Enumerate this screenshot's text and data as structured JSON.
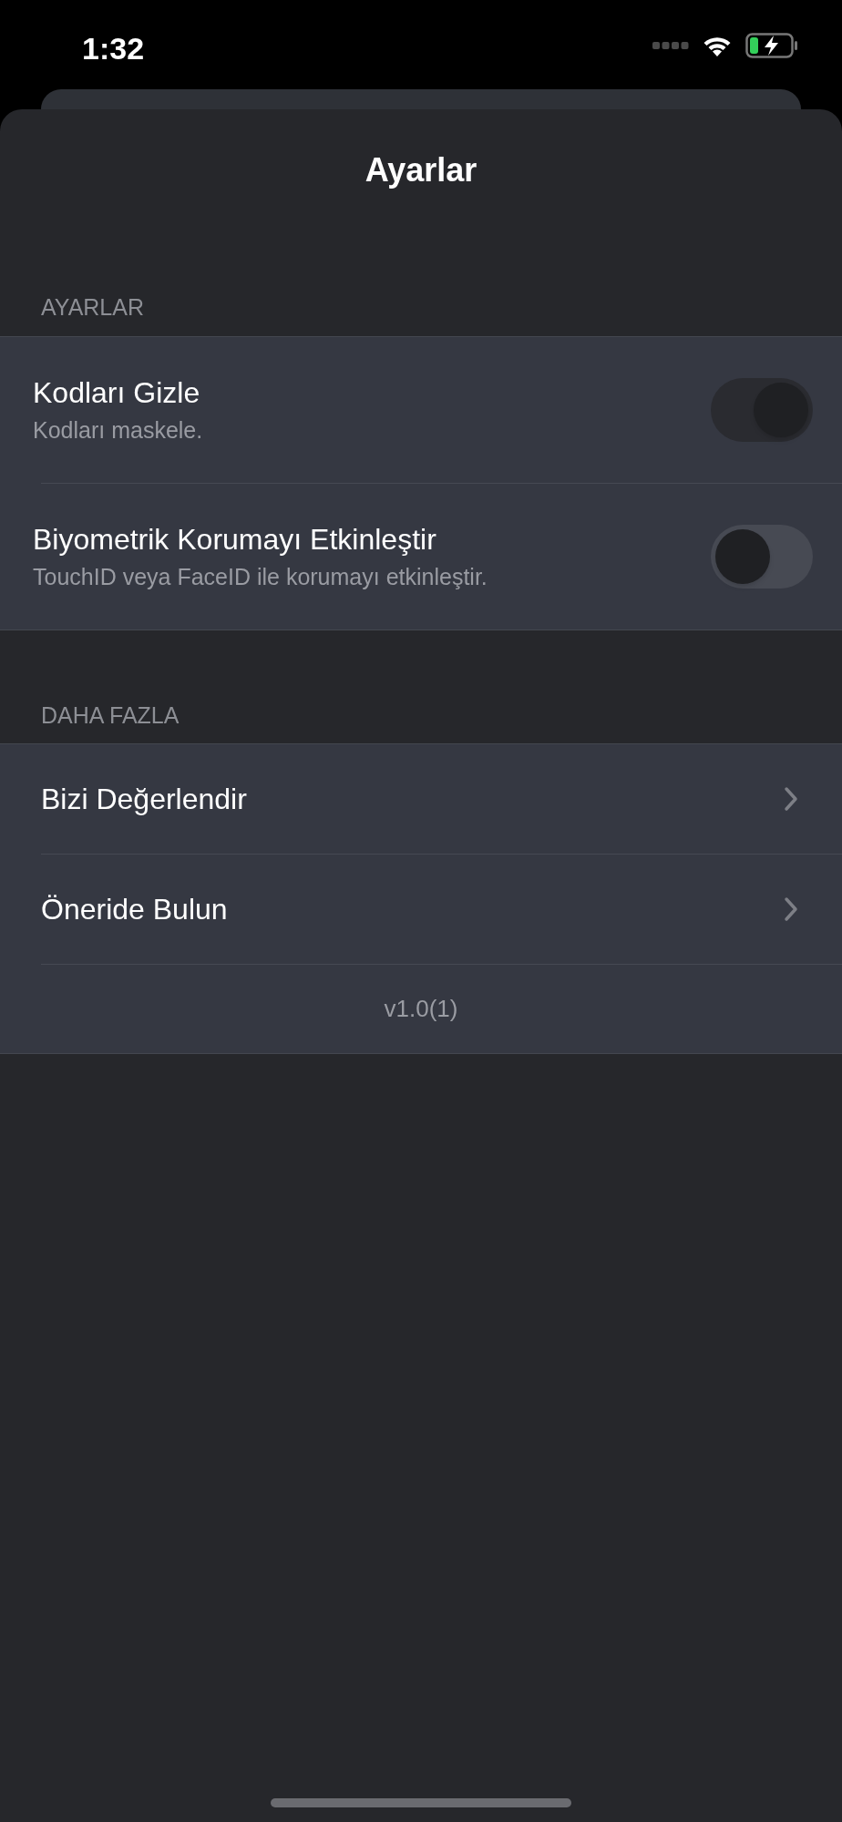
{
  "status_bar": {
    "time": "1:32"
  },
  "title": "Ayarlar",
  "sections": [
    {
      "header": "AYARLAR",
      "rows": [
        {
          "kind": "toggle",
          "title": "Kodları Gizle",
          "subtitle": "Kodları maskele.",
          "on": true
        },
        {
          "kind": "toggle",
          "title": "Biyometrik Korumayı Etkinleştir",
          "subtitle": "TouchID veya FaceID ile korumayı etkinleştir.",
          "on": false
        }
      ]
    },
    {
      "header": "DAHA FAZLA",
      "rows": [
        {
          "kind": "link",
          "title": "Bizi Değerlendir"
        },
        {
          "kind": "link",
          "title": "Öneride Bulun"
        },
        {
          "kind": "footer",
          "title": "v1.0(1)"
        }
      ]
    }
  ]
}
